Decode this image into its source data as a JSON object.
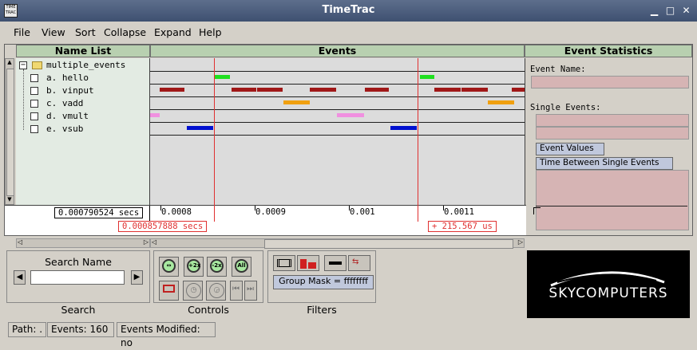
{
  "window": {
    "title": "TimeTrac",
    "app_icon": "TIME TRAC"
  },
  "menubar": [
    "File",
    "View",
    "Sort",
    "Collapse",
    "Expand",
    "Help"
  ],
  "panels": {
    "name_list": "Name List",
    "events": "Events",
    "event_statistics": "Event Statistics"
  },
  "tree": {
    "root": "multiple_events",
    "items": [
      "a. hello",
      "b. vinput",
      "c. vadd",
      "d. vmult",
      "e. vsub"
    ]
  },
  "colors": {
    "hello": "#20e020",
    "vinput": "#a01818",
    "vadd": "#f0a010",
    "vmult": "#f090e0",
    "vsub": "#0010d0",
    "cursor": "#e03030"
  },
  "timeline": {
    "ticks": [
      "0.0008",
      "0.0009",
      "0.001",
      "0.0011"
    ],
    "position_label": "0.000790524 secs",
    "cursor_label": "0.000857888 secs",
    "delta_label": "+ 215.567 us"
  },
  "stats": {
    "event_name_label": "Event Name:",
    "single_events_label": "Single Events:",
    "event_values_btn": "Event Values",
    "time_between_btn": "Time Between Single Events"
  },
  "search": {
    "label": "Search Name",
    "value": "",
    "group": "Search"
  },
  "controls": {
    "group": "Controls",
    "zoom_in": "+2x",
    "zoom_out": "-2x",
    "zoom_all": "All"
  },
  "filters": {
    "group": "Filters",
    "group_mask": "Group Mask = ffffffff"
  },
  "logo": "SKYCOMPUTERS",
  "status": {
    "path": "Path: .",
    "events": "Events: 160",
    "modified": "Events Modified: no"
  }
}
